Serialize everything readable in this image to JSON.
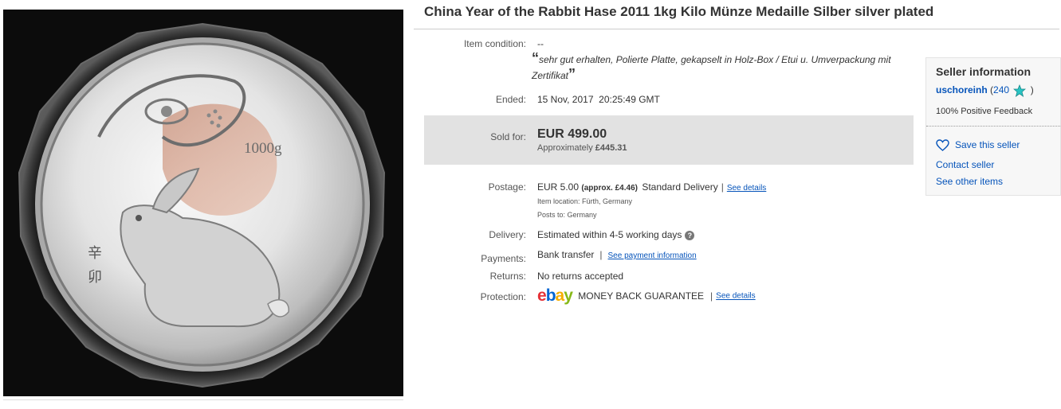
{
  "title": "China Year of the Rabbit Hase 2011 1kg Kilo Münze Medaille Silber silver plated",
  "image": {
    "coin_weight_text": "1000g",
    "coin_char_1": "辛",
    "coin_char_2": "卯"
  },
  "details": {
    "condition_label": "Item condition:",
    "condition_value": "--",
    "condition_quote": "sehr gut erhalten, Polierte Platte, gekapselt in Holz-Box / Etui u. Umverpackung mit Zertifikat",
    "open_quote": "“",
    "close_quote": "”",
    "ended_label": "Ended:",
    "ended_value": "15 Nov, 2017  20:25:49 GMT",
    "sold_label": "Sold for:",
    "sold_price": "EUR 499.00",
    "approx_prefix": "Approximately",
    "approx_value": "£445.31",
    "postage_label": "Postage:",
    "postage_price": "EUR 5.00",
    "postage_approx": "(approx. £4.46)",
    "postage_service": "Standard Delivery",
    "see_details": "See details",
    "item_location": "Item location:  Fürth, Germany",
    "posts_to": "Posts to:  Germany",
    "delivery_label": "Delivery:",
    "delivery_value": "Estimated within 4-5 working days",
    "payments_label": "Payments:",
    "payments_value": "Bank transfer",
    "payment_info_link": "See payment information",
    "returns_label": "Returns:",
    "returns_value": "No returns accepted",
    "protection_label": "Protection:",
    "protection_value": "MONEY BACK GUARANTEE",
    "protection_link": "See details"
  },
  "seller": {
    "heading": "Seller information",
    "username": "uschoreinh",
    "score": "240",
    "open_paren": "(",
    "close_paren": ")",
    "feedback": "100% Positive Feedback",
    "save_seller": "Save this seller",
    "contact_seller": "Contact seller",
    "see_other_items": "See other items"
  },
  "colors": {
    "link": "#0654ba",
    "ebay_e": "#e53238",
    "ebay_b": "#0064d2",
    "ebay_a": "#f5af02",
    "ebay_y": "#86b817",
    "star": "#28c4c4"
  }
}
